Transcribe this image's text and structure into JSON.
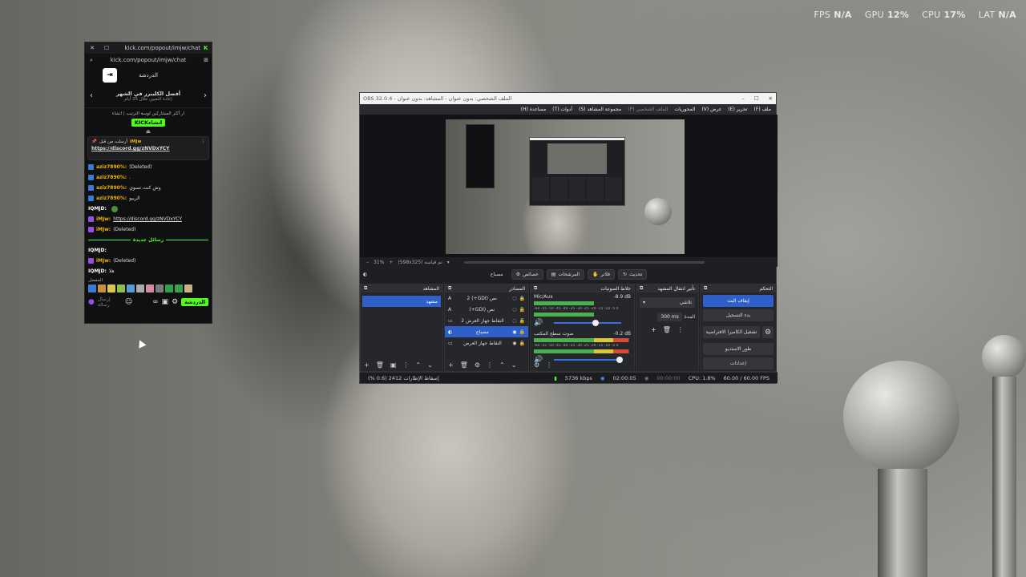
{
  "hud": {
    "fps_label": "FPS",
    "fps_val": "N/A",
    "gpu_label": "GPU",
    "gpu_val": "12%",
    "cpu_label": "CPU",
    "cpu_val": "17%",
    "lat_label": "LAT",
    "lat_val": "N/A"
  },
  "kick": {
    "tab_title": "kick.com/popout/imjw/chat",
    "url": "kick.com/popout/imjw/chat",
    "header": "الدردشة",
    "banner_title": "أفضل الكليبرز في الشهر",
    "banner_sub": "إعادة التعيين خلال 25 أيام",
    "clip_note": "ار أكثر المشاركين لوسة الترتيب | انشاء",
    "kick_btn": "KICKانشاء",
    "pinned_user": "iMJw",
    "pinned_by": "أرسلت من قبل",
    "pinned_link": "https://discord.gg/zNVDxYCY",
    "messages": [
      {
        "user": "aziz7890%:",
        "text": "(Deleted)"
      },
      {
        "user": "aziz7890%:",
        "text": "."
      },
      {
        "user": "aziz7890%:",
        "text": "وش كنت تسوي"
      },
      {
        "user": "aziz7890%:",
        "text": "الريبو"
      },
      {
        "user": "IQMJD:",
        "text": ""
      },
      {
        "user": "iMJw:",
        "text": "https://discord.gg/zNVDxYCY"
      },
      {
        "user": "iMJw:",
        "text": "(Deleted)"
      }
    ],
    "divider": "رسائل جديدة",
    "messages2": [
      {
        "user": "IQMJD:",
        "text": ""
      },
      {
        "user": "iMJw:",
        "text": "(Deleted)"
      },
      {
        "user": "IQMJD:",
        "text": "هلا"
      }
    ],
    "emotes_label": "المفضل",
    "send_placeholder": "إرسال رسالة",
    "chat_btn": "الدردشة"
  },
  "obs": {
    "title": "OBS 32.0.4 - الملف الشخصي: بدون عنوان - المشاهد: بدون عنوان",
    "menu": [
      "ملف (F)",
      "تحرير (E)",
      "عرض (V)",
      "المحوريات",
      "الملف الشخصي (P)",
      "مجموعة المشاهد (S)",
      "أدوات (T)",
      "مساعدة (H)"
    ],
    "zoom": "31%",
    "resolution": "(598x325) تم قياسه",
    "toolbar": [
      "تحديث",
      "فلاتر",
      "المرشحات",
      "خصائص",
      "مصدر"
    ],
    "toolbar_source": "مصباح",
    "docks": {
      "scenes": "المشاهد",
      "sources": "المصادر",
      "mixer": "خلاط الصوتيات",
      "transitions": "تأثير انتقال المشهد",
      "controls": "التحكم"
    },
    "scenes": [
      "مشهد"
    ],
    "sources": [
      {
        "name": "نص (GDI+) 2"
      },
      {
        "name": "نص (GDI+)"
      },
      {
        "name": "التقاط جهاز العرض 2"
      },
      {
        "name": "مصباح"
      },
      {
        "name": "التقاط جهاز العرض"
      }
    ],
    "mixer": [
      {
        "name": "Mic/Aux",
        "db": "-8.9 dB",
        "level": 0.62
      },
      {
        "name": "صوت سطح المكتب",
        "db": "-0.2 dB",
        "level": 0.98
      }
    ],
    "mixer_scale": "-60 -55 -50 -45 -40 -35 -30 -25 -20 -15 -10 -5 0",
    "transition": {
      "type": "تلاشي",
      "duration_label": "المدة",
      "duration": "300 ms"
    },
    "controls": [
      "إيقاف البث",
      "بدء التسجيل",
      "تشغيل الكاميرا الافتراضية",
      "طور الاستديو",
      "إعدادات"
    ],
    "status": {
      "dropped": "إسقاط الإطارات 2412 (0.6 %)",
      "bitrate": "5736 kbps",
      "live_time": "02:00:05",
      "rec_time": "00:00:00",
      "cpu": "CPU: 1.8%",
      "fps": "60.00 / 60.00 FPS"
    }
  }
}
